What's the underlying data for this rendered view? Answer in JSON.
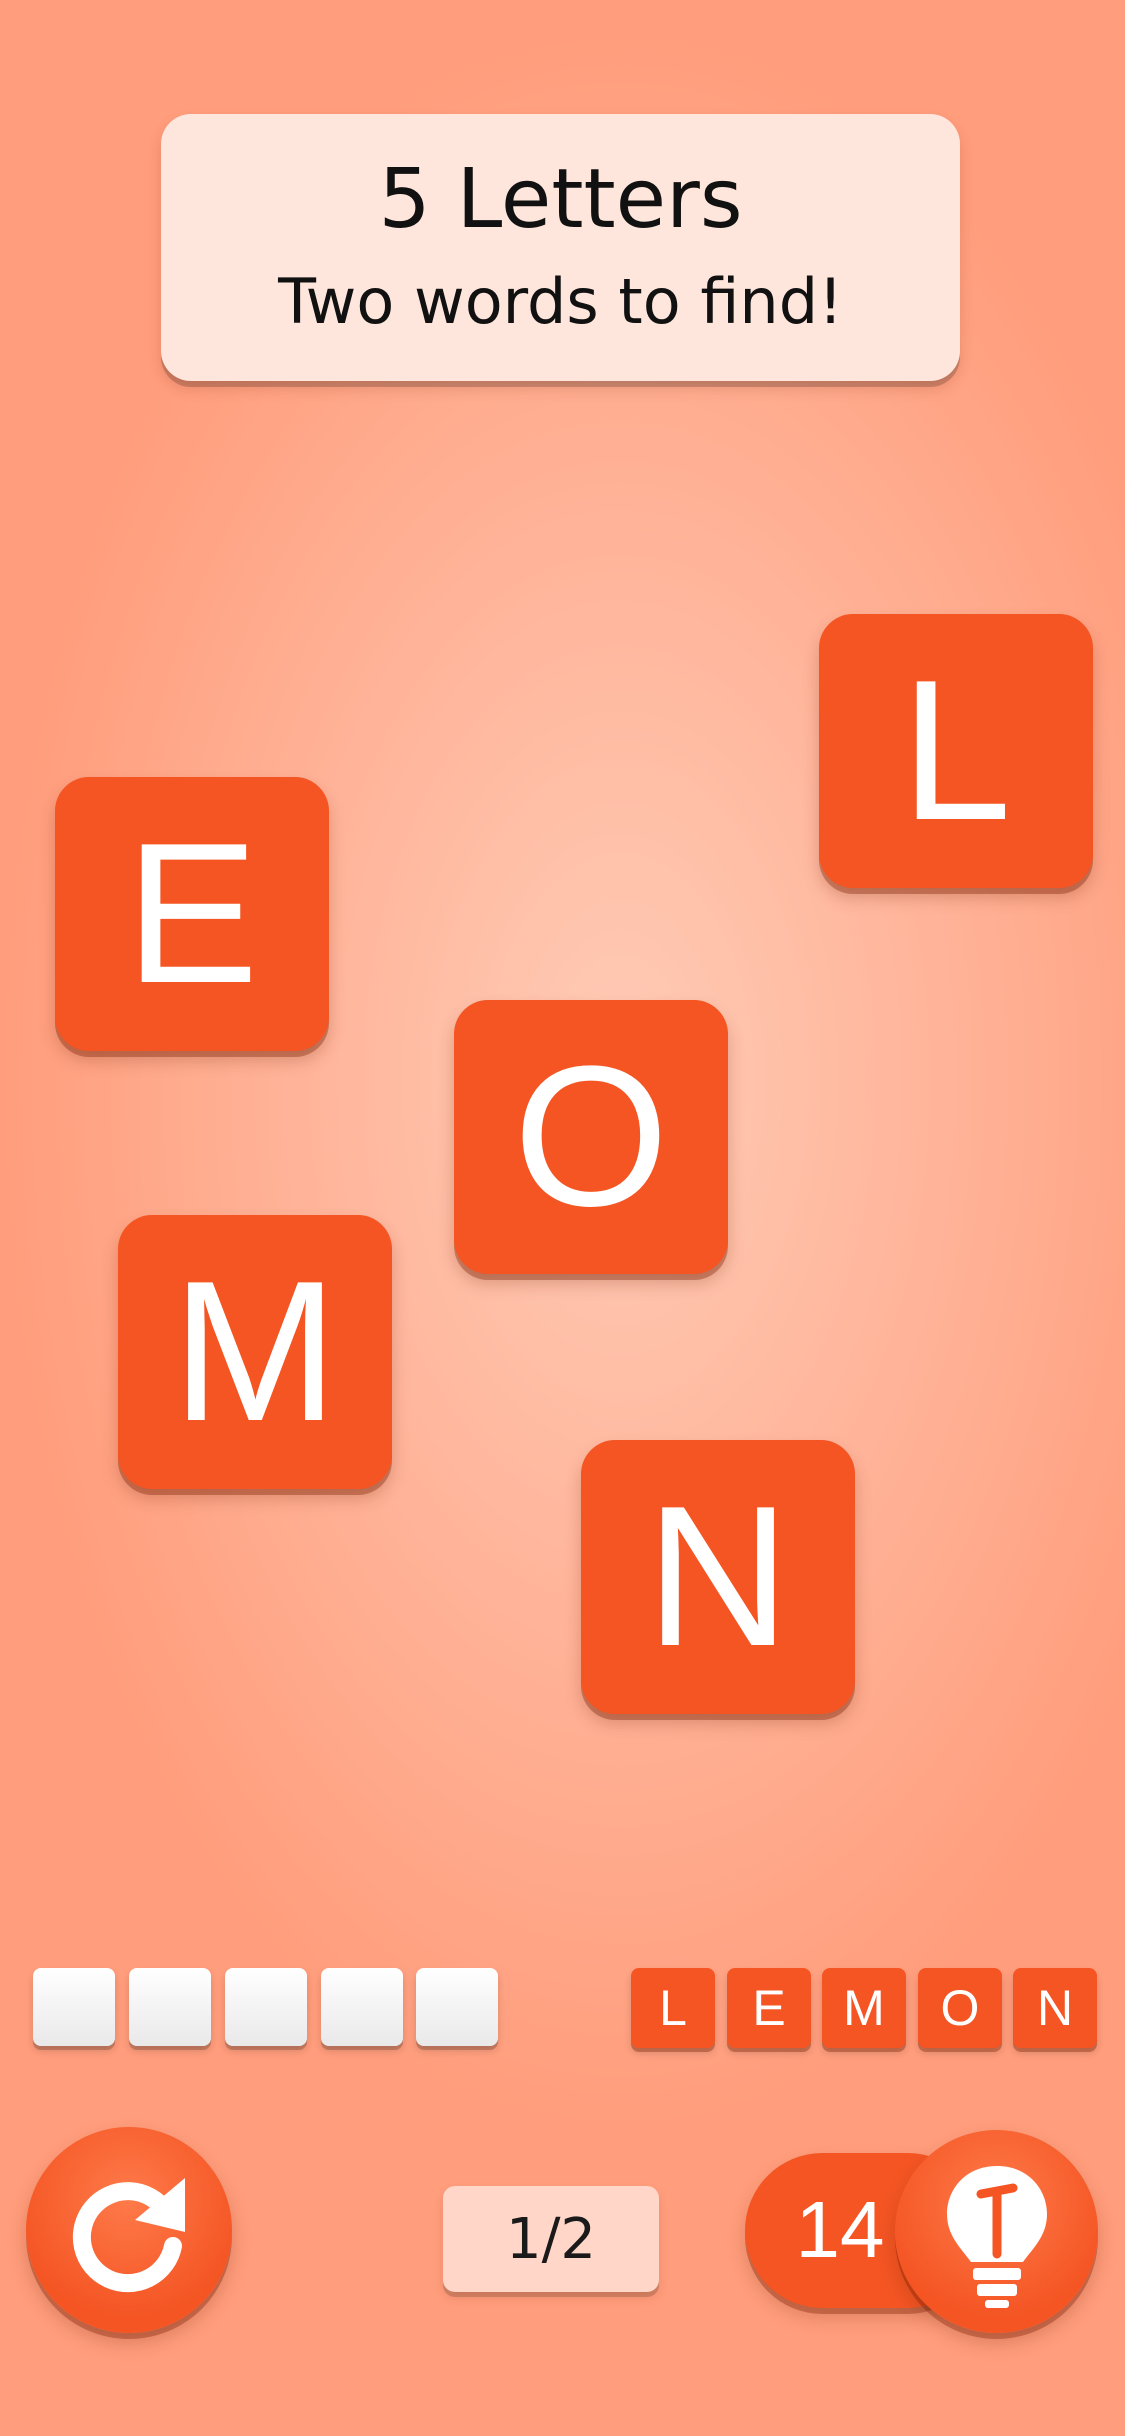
{
  "header": {
    "title": "5 Letters",
    "subtitle": "Two words to find!"
  },
  "board": {
    "letters": [
      "L",
      "E",
      "O",
      "M",
      "N"
    ]
  },
  "answer_slots": {
    "count": 5,
    "found_word": [
      "L",
      "E",
      "M",
      "O",
      "N"
    ]
  },
  "controls": {
    "restart_icon": "restart-icon",
    "progress": "1/2",
    "hints_count": "14",
    "hint_icon": "lightbulb-icon"
  },
  "colors": {
    "tile": "#f45523",
    "background": "#ffb79d",
    "header_card": "#ffe6dd",
    "progress_pill": "#ffd6c8"
  }
}
